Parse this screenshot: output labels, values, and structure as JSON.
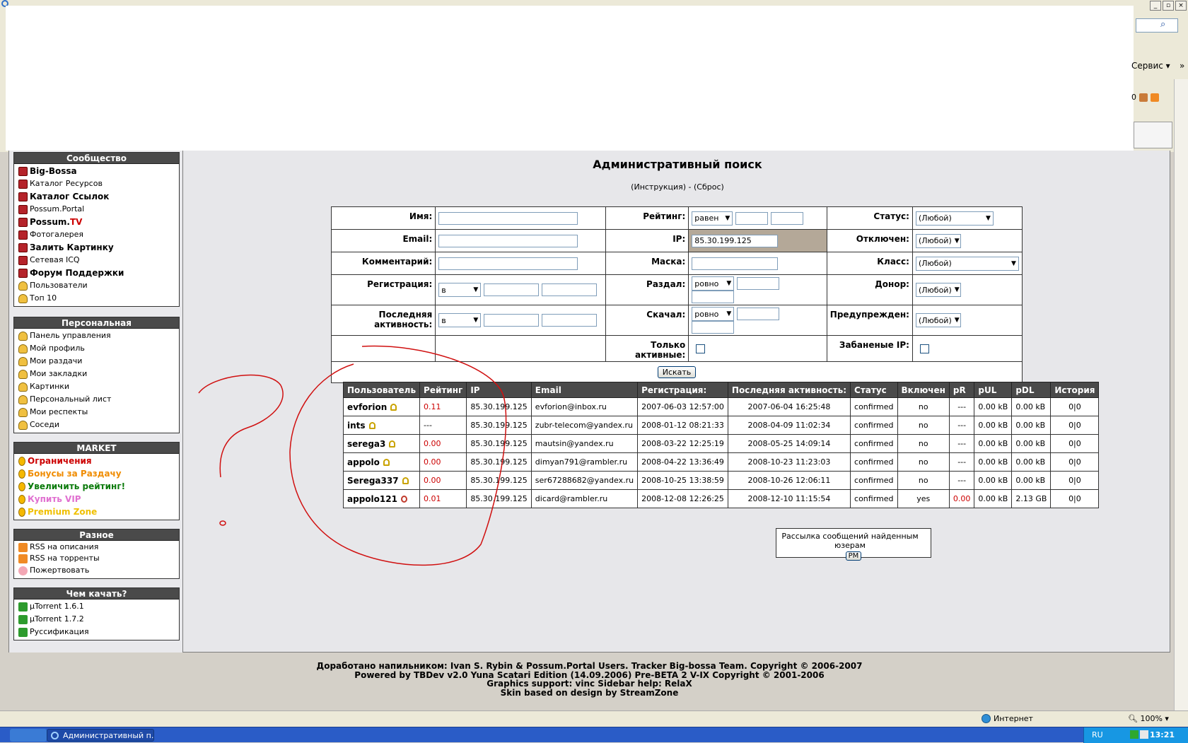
{
  "browser": {
    "tools_menu": "Сервис",
    "tools_more": "»",
    "counter": "0",
    "status_zone": "Интернет",
    "zoom": "100%"
  },
  "taskbar": {
    "task_title": "Административный п...",
    "lang": "RU",
    "clock": "13:21"
  },
  "sidebar": {
    "community": {
      "title": "Сообщество",
      "items": [
        {
          "label": "Big-Bossa"
        },
        {
          "label": "Каталог Ресурсов"
        },
        {
          "label": "Каталог Ссылок"
        },
        {
          "label": "Possum.Portal"
        },
        {
          "label_a": "Possum.",
          "label_b": "TV"
        },
        {
          "label": "Фотогалерея"
        },
        {
          "label": "Залить Картинку"
        },
        {
          "label": "Сетевая ICQ"
        },
        {
          "label": "Форум Поддержки"
        },
        {
          "label": "Пользователи"
        },
        {
          "label": "Топ 10"
        }
      ]
    },
    "personal": {
      "title": "Персональная",
      "items": [
        {
          "label": "Панель управления"
        },
        {
          "label": "Мой профиль"
        },
        {
          "label": "Мои раздачи"
        },
        {
          "label": "Мои закладки"
        },
        {
          "label": "Картинки"
        },
        {
          "label": "Персональный лист"
        },
        {
          "label": "Мои респекты"
        },
        {
          "label": "Соседи"
        }
      ]
    },
    "market": {
      "title": "MARKET",
      "items": [
        {
          "label": "Ограничения"
        },
        {
          "label": "Бонусы за Раздачу"
        },
        {
          "label": "Увеличить рейтинг!"
        },
        {
          "label": "Купить VIP"
        },
        {
          "label": "Premium Zone"
        }
      ]
    },
    "misc": {
      "title": "Разное",
      "items": [
        {
          "label": "RSS на описания"
        },
        {
          "label": "RSS на торренты"
        },
        {
          "label": "Пожертвовать"
        }
      ]
    },
    "download": {
      "title": "Чем качать?",
      "items": [
        {
          "label": "µTorrent 1.6.1"
        },
        {
          "label": "µTorrent 1.7.2"
        },
        {
          "label": "Руссификация"
        }
      ]
    }
  },
  "main": {
    "title": "Административный поиск",
    "subtitle": {
      "open": "(",
      "instruction": "Инструкция",
      "mid": ") - (",
      "reset": "Сброс",
      "close": ")"
    },
    "form": {
      "name_label": "Имя:",
      "email_label": "Email:",
      "comment_label": "Комментарий:",
      "reg_label": "Регистрация:",
      "reg_op": "в",
      "last_label": "Последняя активность:",
      "last_op": "в",
      "rating_label": "Рейтинг:",
      "rating_op": "равен",
      "ip_label": "IP:",
      "ip_value": "85.30.199.125",
      "mask_label": "Маска:",
      "uploaded_label": "Раздал:",
      "uploaded_op": "ровно",
      "downloaded_label": "Скачал:",
      "downloaded_op": "ровно",
      "active_only_label": "Только активные:",
      "status_label": "Статус:",
      "status_value": "(Любой)",
      "disabled_label": "Отключен:",
      "disabled_value": "(Любой)",
      "class_label": "Класс:",
      "class_value": "(Любой)",
      "donor_label": "Донор:",
      "donor_value": "(Любой)",
      "warned_label": "Предупрежден:",
      "warned_value": "(Любой)",
      "banned_ip_label": "Забаненые IP:",
      "search_button": "Искать"
    },
    "results": {
      "headers": [
        "Пользователь",
        "Рейтинг",
        "IP",
        "Email",
        "Регистрация:",
        "Последняя активность:",
        "Статус",
        "Включен",
        "pR",
        "pUL",
        "pDL",
        "История"
      ],
      "rows": [
        {
          "user": "evforion",
          "rating": "0.11",
          "ip": "85.30.199.125",
          "email": "evforion@inbox.ru",
          "reg": "2007-06-03 12:57:00",
          "last": "2007-06-04 16:25:48",
          "status": "confirmed",
          "enabled": "no",
          "pr": "---",
          "pul": "0.00 kB",
          "pdl": "0.00 kB",
          "history": "0|0"
        },
        {
          "user": "ints",
          "rating": "---",
          "ip": "85.30.199.125",
          "email": "zubr-telecom@yandex.ru",
          "reg": "2008-01-12 08:21:33",
          "last": "2008-04-09 11:02:34",
          "status": "confirmed",
          "enabled": "no",
          "pr": "---",
          "pul": "0.00 kB",
          "pdl": "0.00 kB",
          "history": "0|0"
        },
        {
          "user": "serega3",
          "rating": "0.00",
          "ip": "85.30.199.125",
          "email": "mautsin@yandex.ru",
          "reg": "2008-03-22 12:25:19",
          "last": "2008-05-25 14:09:14",
          "status": "confirmed",
          "enabled": "no",
          "pr": "---",
          "pul": "0.00 kB",
          "pdl": "0.00 kB",
          "history": "0|0"
        },
        {
          "user": "appolo",
          "rating": "0.00",
          "ip": "85.30.199.125",
          "email": "dimyan791@rambler.ru",
          "reg": "2008-04-22 13:36:49",
          "last": "2008-10-23 11:23:03",
          "status": "confirmed",
          "enabled": "no",
          "pr": "---",
          "pul": "0.00 kB",
          "pdl": "0.00 kB",
          "history": "0|0"
        },
        {
          "user": "Serega337",
          "rating": "0.00",
          "ip": "85.30.199.125",
          "email": "ser67288682@yandex.ru",
          "reg": "2008-10-25 13:38:59",
          "last": "2008-10-26 12:06:11",
          "status": "confirmed",
          "enabled": "no",
          "pr": "---",
          "pul": "0.00 kB",
          "pdl": "0.00 kB",
          "history": "0|0"
        },
        {
          "user": "appolo121",
          "rating": "0.01",
          "ip": "85.30.199.125",
          "email": "dicard@rambler.ru",
          "reg": "2008-12-08 12:26:25",
          "last": "2008-12-10 11:15:54",
          "status": "confirmed",
          "enabled": "yes",
          "pr": "0.00",
          "pul": "0.00 kB",
          "pdl": "2.13 GB",
          "history": "0|0"
        }
      ]
    },
    "mass_pm": {
      "label": "Рассылка сообщений найденным юзерам",
      "button": "PM"
    }
  },
  "footer": {
    "line1": "Доработано напильником: Ivan S. Rybin & Possum.Portal Users. Tracker Big-bossa Team. Copyright © 2006-2007",
    "line2": "Powered by TBDev v2.0 Yuna Scatari Edition (14.09.2006) Pre-BETA 2 V-IX Copyright © 2001-2006",
    "line3": "Graphics support: vinc Sidebar help: RelaX",
    "line4": "Skin based on design by StreamZone"
  },
  "colors": {
    "accent_red": "#cc0000",
    "header_bg": "#4a4a4a",
    "ip_highlight": "#b4a898",
    "scribble": "#d01010"
  }
}
